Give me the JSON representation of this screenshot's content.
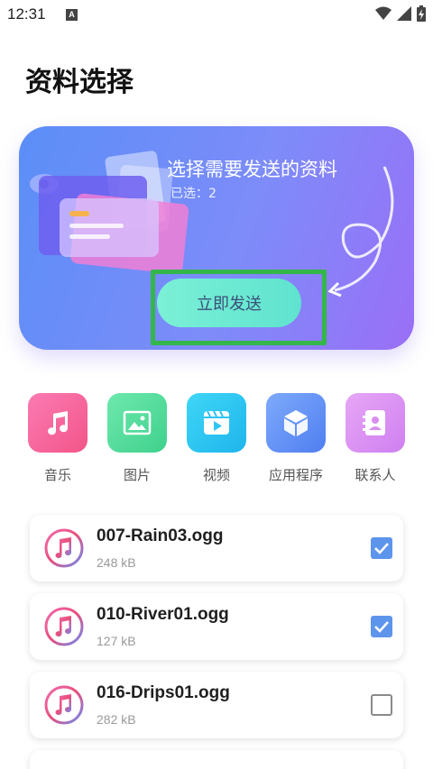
{
  "status_bar": {
    "time": "12:31",
    "notification_badge": "A"
  },
  "page": {
    "title": "资料选择"
  },
  "banner": {
    "title": "选择需要发送的资料",
    "selected_text": "已选：2",
    "send_button": "立即发送"
  },
  "categories": [
    {
      "label": "音乐",
      "icon": "music-icon",
      "color": "#f6679c"
    },
    {
      "label": "图片",
      "icon": "image-icon",
      "color": "#4fdc9a"
    },
    {
      "label": "视频",
      "icon": "video-icon",
      "color": "#2fc4f2"
    },
    {
      "label": "应用程序",
      "icon": "cube-icon",
      "color": "#5e8df6"
    },
    {
      "label": "联系人",
      "icon": "contact-icon",
      "color": "#d98ef0"
    }
  ],
  "files": [
    {
      "name": "007-Rain03.ogg",
      "size": "248 kB",
      "checked": true
    },
    {
      "name": "010-River01.ogg",
      "size": "127 kB",
      "checked": true
    },
    {
      "name": "016-Drips01.ogg",
      "size": "282 kB",
      "checked": false
    }
  ],
  "colors": {
    "accent": "#5d94ec",
    "highlight": "#34b64a",
    "button": "#6ee8d3"
  }
}
